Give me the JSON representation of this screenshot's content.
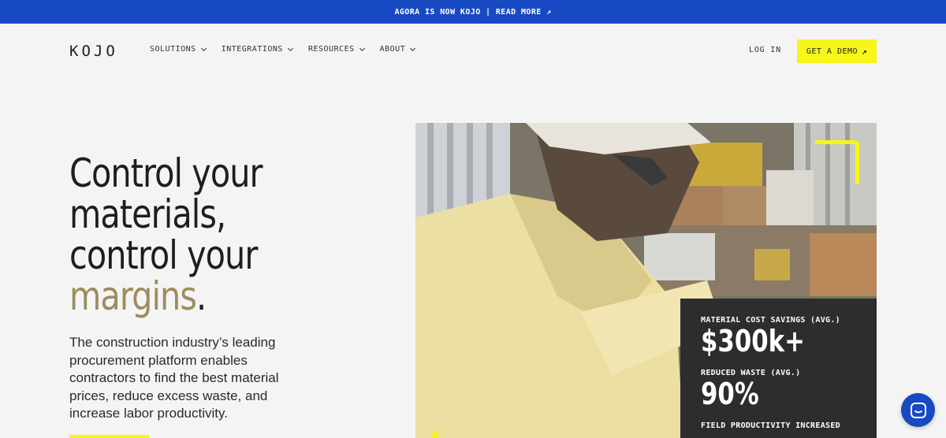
{
  "banner": {
    "text": "AGORA IS NOW KOJO | READ MORE ↗"
  },
  "nav": {
    "logo": "KOJO",
    "items": [
      {
        "label": "SOLUTIONS"
      },
      {
        "label": "INTEGRATIONS"
      },
      {
        "label": "RESOURCES"
      },
      {
        "label": "ABOUT"
      }
    ],
    "login": "LOG IN",
    "demo": "GET A DEMO",
    "demo_icon": "↗"
  },
  "hero": {
    "headline_line1": "Control your",
    "headline_line2": "materials,",
    "headline_line3": "control your",
    "headline_accent": "margins",
    "headline_period": ".",
    "subtext": "The construction industry’s leading procurement platform enables contractors to find the best material prices, reduce excess waste, and increase labor productivity."
  },
  "stats": [
    {
      "label": "MATERIAL COST SAVINGS (AVG.)",
      "value": "$300k+"
    },
    {
      "label": "REDUCED WASTE (AVG.)",
      "value": "90%"
    },
    {
      "label": "FIELD PRODUCTIVITY INCREASED",
      "value": ""
    }
  ],
  "colors": {
    "brand_blue": "#1749c3",
    "accent_yellow": "#f8f518",
    "accent_gold": "#9e8c5f",
    "dark_panel": "#2d2d2d"
  },
  "icons": {
    "chat": "chat-bubble-icon",
    "external": "arrow-up-right-icon"
  }
}
